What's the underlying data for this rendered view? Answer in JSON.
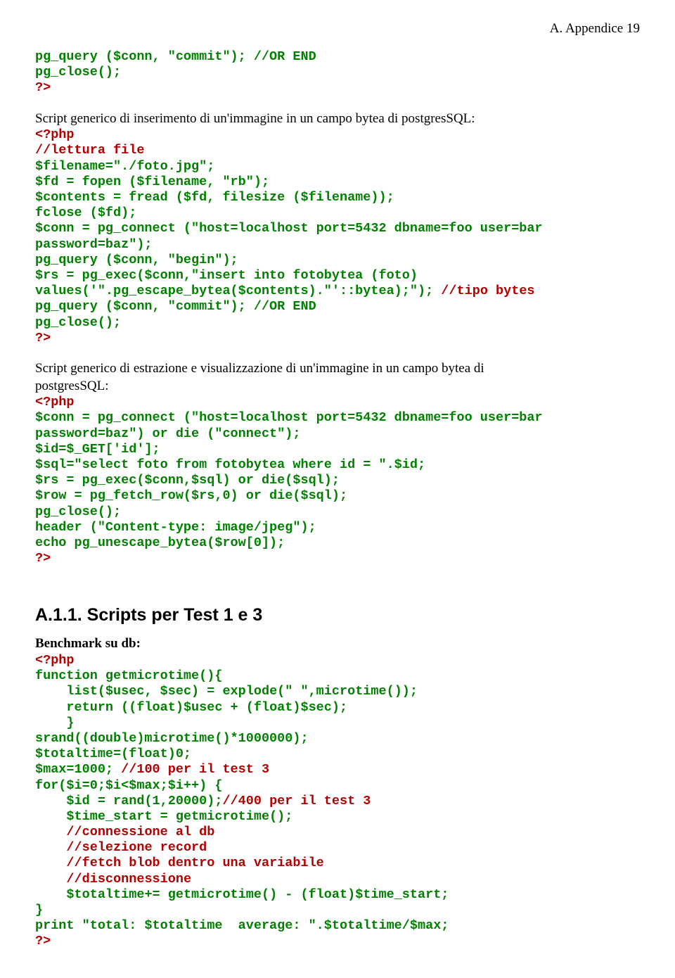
{
  "header_right": "A. Appendice 19",
  "block1": {
    "l1": "pg_query ($conn, \"commit\"); //OR END",
    "l2": "pg_close();",
    "l3": "?>"
  },
  "para1": "Script generico di inserimento di un'immagine in un campo bytea di postgresSQL:",
  "block2": {
    "a1": "<?php",
    "a2": "//lettura file",
    "a3": "$filename=\"./foto.jpg\";",
    "a4": "$fd = fopen ($filename, \"rb\");",
    "a5": "$contents = fread ($fd, filesize ($filename));",
    "a6": "fclose ($fd);",
    "a7a": "$conn = pg_connect (\"host=localhost port=5432 dbname=foo user=bar",
    "a7b": "password=baz\");",
    "a8": "pg_query ($conn, \"begin\");",
    "a9a": "$rs = pg_exec($conn,\"insert into fotobytea (foto)",
    "a9b": "values('\".pg_escape_bytea($contents).\"'::bytea);\");",
    "a9c": " //tipo bytes",
    "a10": "pg_query ($conn, \"commit\"); //OR END",
    "a11": "pg_close();",
    "a12": "?>"
  },
  "para2a": "Script generico di estrazione e visualizzazione di un'immagine in un campo bytea di",
  "para2b": "postgresSQL:",
  "block3": {
    "b1": "<?php",
    "b2a": "$conn = pg_connect (\"host=localhost port=5432 dbname=foo user=bar",
    "b2b": "password=baz\") or die (\"connect\");",
    "b3": "$id=$_GET['id'];",
    "b4": "$sql=\"select foto from fotobytea where id = \".$id;",
    "b5": "$rs = pg_exec($conn,$sql) or die($sql);",
    "b6": "$row = pg_fetch_row($rs,0) or die($sql);",
    "b7": "pg_close();",
    "b8": "header (\"Content-type: image/jpeg\");",
    "b9": "echo pg_unescape_bytea($row[0]);",
    "b10": "?>"
  },
  "h2": "A.1.1. Scripts per Test 1 e 3",
  "para3": "Benchmark su db:",
  "block4": {
    "c1": "<?php",
    "c2": "function getmicrotime(){",
    "c3": "    list($usec, $sec) = explode(\" \",microtime());",
    "c4": "    return ((float)$usec + (float)$sec);",
    "c5": "    }",
    "c6": "srand((double)microtime()*1000000);",
    "c7": "$totaltime=(float)0;",
    "c8a": "$max=1000;",
    "c8b": " //100 per il test 3",
    "c9": "for($i=0;$i<$max;$i++) {",
    "c10a": "    $id = rand(1,20000);",
    "c10b": "//400 per il test 3",
    "c11": "    $time_start = getmicrotime();",
    "c12": "    //connessione al db",
    "c13": "    //selezione record",
    "c14": "    //fetch blob dentro una variabile",
    "c15": "    //disconnessione",
    "c16": "    $totaltime+= getmicrotime() - (float)$time_start;",
    "c17": "}",
    "c18": "print \"total: $totaltime  average: \".$totaltime/$max;",
    "c19": "?>"
  }
}
